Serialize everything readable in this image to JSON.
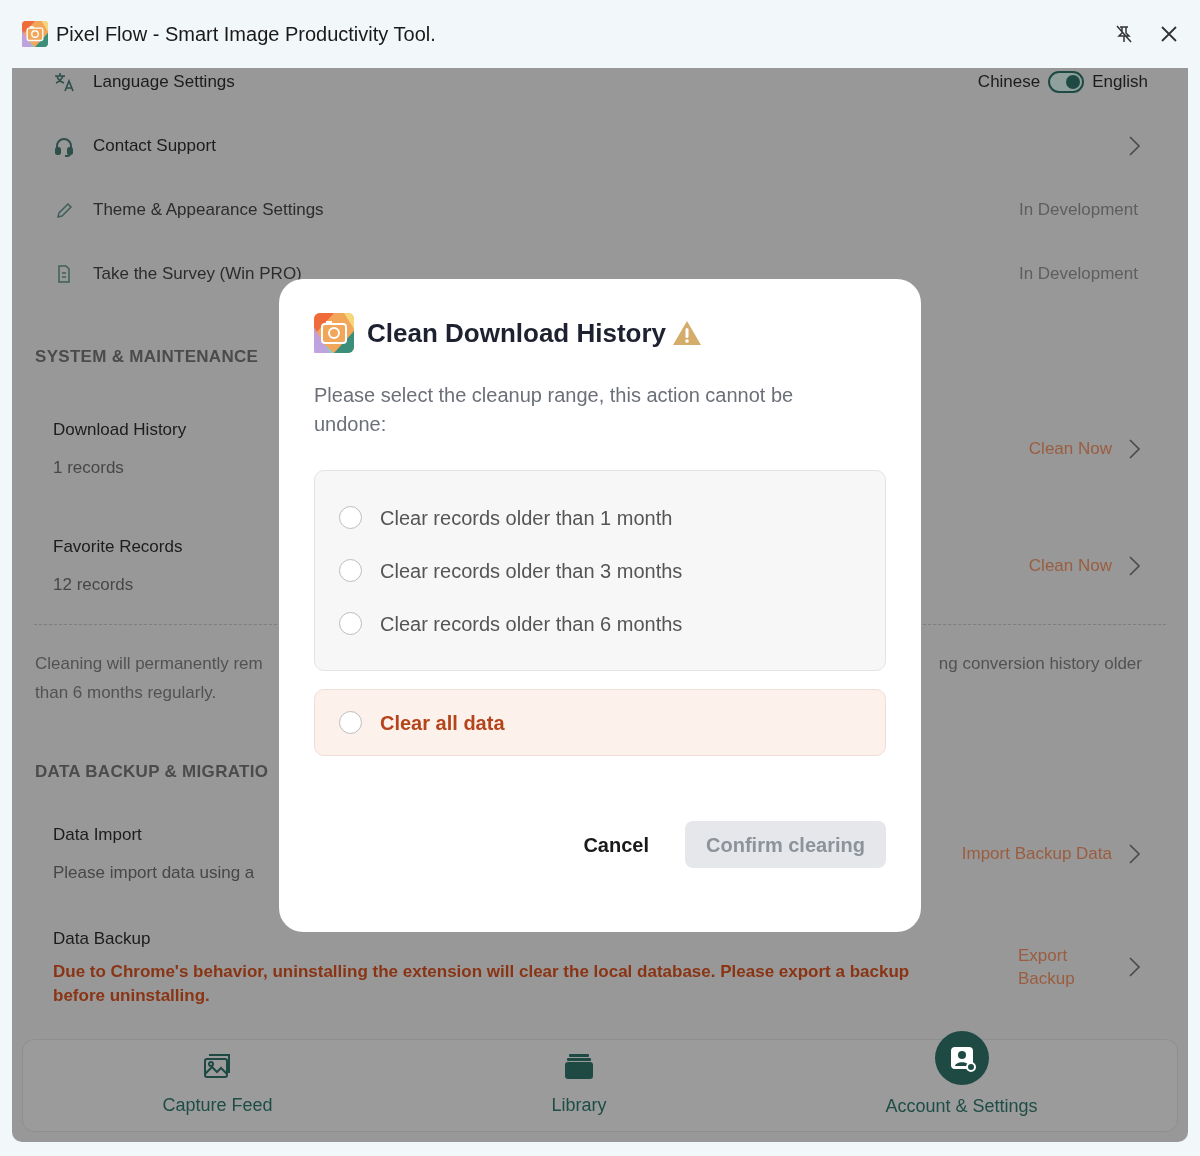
{
  "window": {
    "title": "Pixel Flow - Smart Image Productivity Tool."
  },
  "settings": [
    {
      "kind": "toggle",
      "label": "Language Settings",
      "option_left": "Chinese",
      "option_right": "English",
      "on": true
    },
    {
      "kind": "link",
      "label": "Contact Support"
    },
    {
      "kind": "status",
      "label": "Theme & Appearance Settings",
      "status": "In Development"
    },
    {
      "kind": "status",
      "label": "Take the Survey (Win PRO)",
      "status": "In Development"
    }
  ],
  "sections": [
    {
      "heading": "SYSTEM & MAINTENANCE",
      "items": [
        {
          "title": "Download History",
          "subtitle": "1 records",
          "action": "Clean Now"
        },
        {
          "title": "Favorite Records",
          "subtitle": "12 records",
          "action": "Clean Now"
        }
      ],
      "note_left": [
        "Cleaning will permanently rem",
        "than 6 months regularly."
      ],
      "note_right": "ng conversion history older"
    },
    {
      "heading": "DATA BACKUP & MIGRATIO",
      "items": [
        {
          "title": "Data Import",
          "subtitle": "Please import data using a",
          "action": "Import Backup Data"
        }
      ]
    }
  ],
  "backup": {
    "title": "Data Backup",
    "warning": "Due to Chrome's behavior, uninstalling the extension will clear the local database. Please export a backup before uninstalling.",
    "action": "Export Backup"
  },
  "nav": [
    {
      "label": "Capture Feed",
      "selected": false,
      "kind": "feed"
    },
    {
      "label": "Library",
      "selected": false,
      "kind": "library"
    },
    {
      "label": "Account & Settings",
      "selected": true,
      "kind": "account"
    }
  ],
  "dialog": {
    "title": "Clean Download History",
    "message": "Please select the cleanup range, this action cannot be undone:",
    "options": [
      {
        "kind": "range",
        "label": "Clear records older than 1 month",
        "selected": false
      },
      {
        "kind": "range",
        "label": "Clear records older than 3 months",
        "selected": false
      },
      {
        "kind": "range",
        "label": "Clear records older than 6 months",
        "selected": false
      },
      {
        "kind": "danger",
        "label": "Clear all data",
        "selected": false
      }
    ],
    "cancel": "Cancel",
    "confirm": {
      "label": "Confirm clearing",
      "disabled": true
    }
  }
}
